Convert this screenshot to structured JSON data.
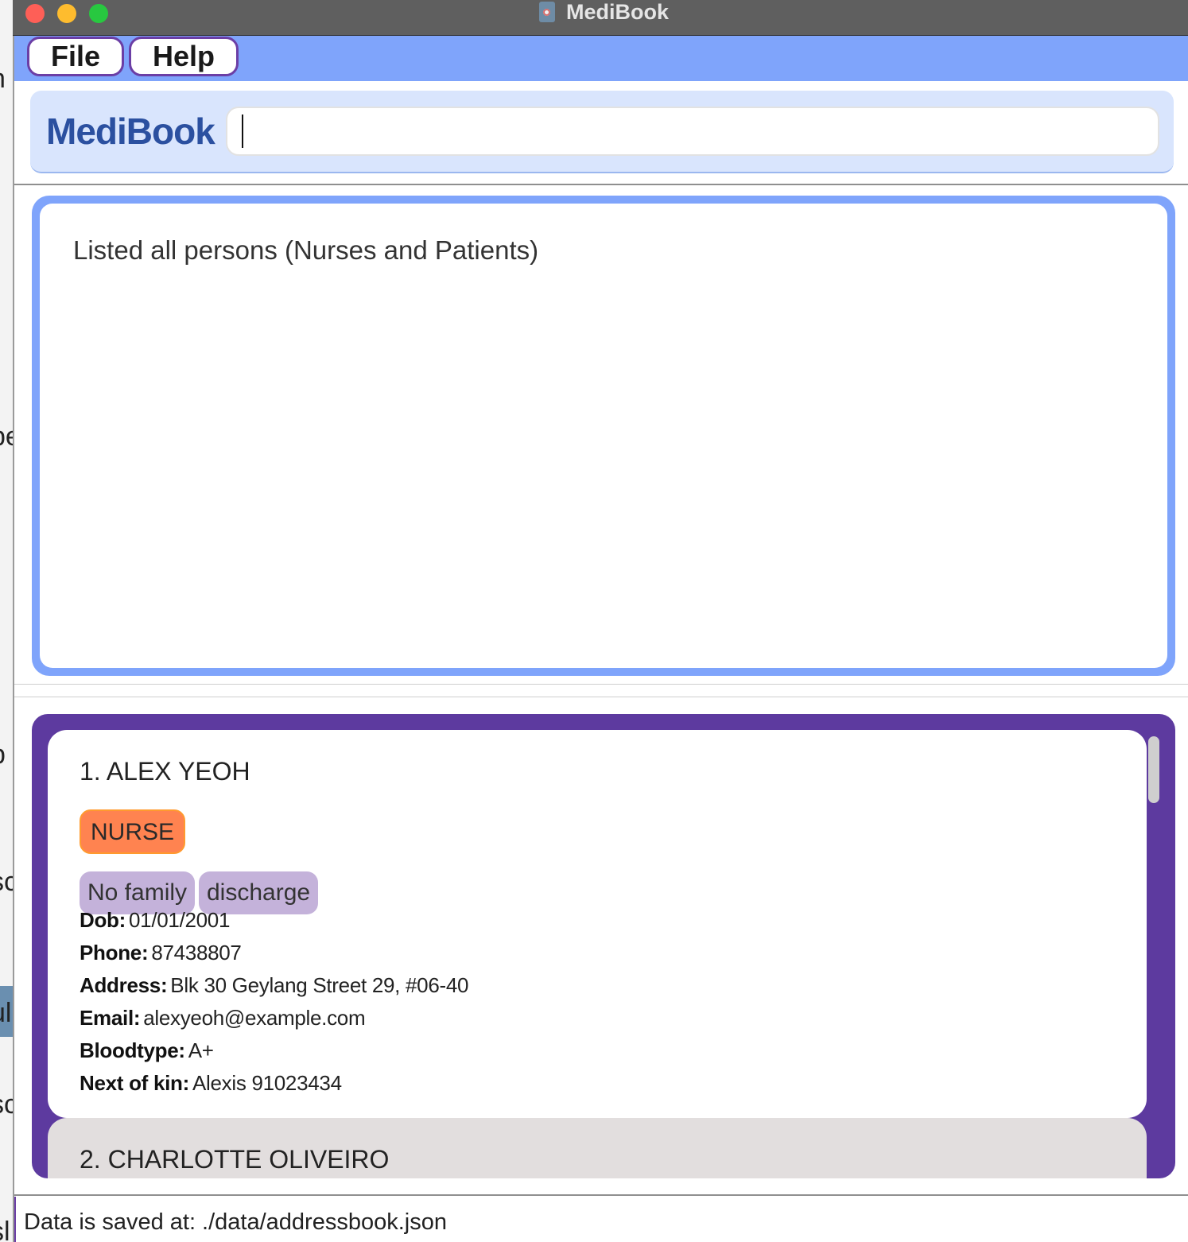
{
  "window": {
    "title": "MediBook"
  },
  "menu": {
    "file_label": "File",
    "help_label": "Help"
  },
  "header": {
    "app_name": "MediBook",
    "command_value": ""
  },
  "result": {
    "message": "Listed all persons (Nurses and Patients)"
  },
  "persons": [
    {
      "index_name": "1.  ALEX YEOH",
      "role": "NURSE",
      "tags": [
        "No family",
        "discharge"
      ],
      "dob_label": "Dob:",
      "dob": "01/01/2001",
      "phone_label": "Phone:",
      "phone": "87438807",
      "address_label": "Address:",
      "address": "Blk 30 Geylang Street 29, #06-40",
      "email_label": "Email:",
      "email": "alexyeoh@example.com",
      "bloodtype_label": "Bloodtype:",
      "bloodtype": "A+",
      "kin_label": "Next of kin:",
      "kin": "Alexis 91023434"
    },
    {
      "index_name": "2.  CHARLOTTE OLIVEIRO"
    }
  ],
  "status": {
    "save_location": "Data is saved at: ./data/addressbook.json"
  },
  "colors": {
    "menubar": "#7fa4fb",
    "accent_purple": "#5d3a9f",
    "nurse_badge": "#ff8350",
    "tag": "#c4b2da",
    "brand_text": "#2b50a0"
  }
}
